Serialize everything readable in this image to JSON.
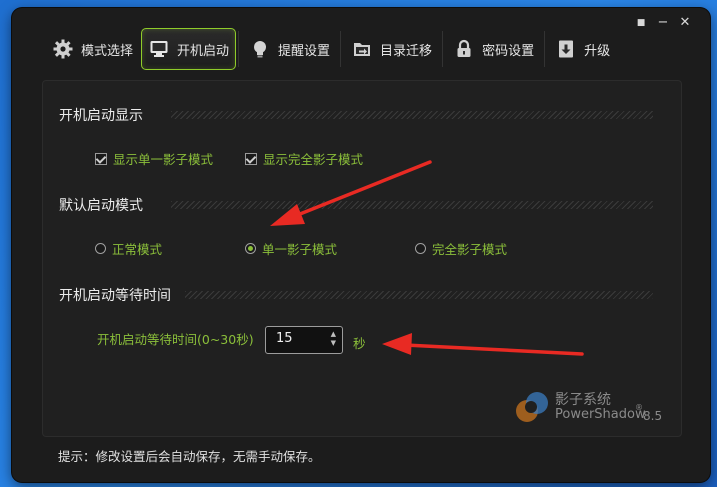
{
  "window": {
    "controls": {
      "pin": "■",
      "minimize": "−",
      "close": "✕"
    }
  },
  "toolbar": {
    "tabs": [
      {
        "label": "模式选择",
        "icon": "gear-icon"
      },
      {
        "label": "开机启动",
        "icon": "monitor-icon",
        "active": true
      },
      {
        "label": "提醒设置",
        "icon": "bulb-icon"
      },
      {
        "label": "目录迁移",
        "icon": "folder-icon"
      },
      {
        "label": "密码设置",
        "icon": "lock-icon"
      },
      {
        "label": "升级",
        "icon": "upgrade-icon"
      }
    ]
  },
  "sections": {
    "boot_display": {
      "title": "开机启动显示",
      "options": [
        "显示单一影子模式",
        "显示完全影子模式"
      ]
    },
    "default_mode": {
      "title": "默认启动模式",
      "options": [
        "正常模式",
        "单一影子模式",
        "完全影子模式"
      ],
      "selected": "单一影子模式"
    },
    "wait_time": {
      "title": "开机启动等待时间",
      "label": "开机启动等待时间(0~30秒)",
      "value": "15",
      "unit": "秒"
    }
  },
  "brand": {
    "name_cn": "影子系统",
    "name_en": "PowerShadow",
    "reg": "®",
    "version": "8.5"
  },
  "footer": {
    "note": "提示：修改设置后会自动保存，无需手动保存。"
  },
  "colors": {
    "accent": "#8fcc2a",
    "option_text": "#8bbf3a",
    "arrow": "#e82a23"
  }
}
